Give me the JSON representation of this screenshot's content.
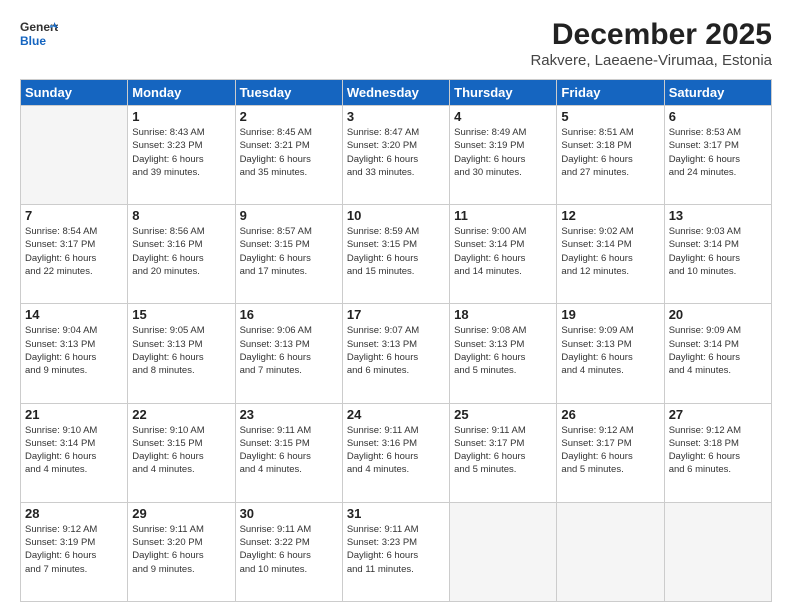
{
  "header": {
    "logo_line1": "General",
    "logo_line2": "Blue",
    "title": "December 2025",
    "subtitle": "Rakvere, Laeaene-Virumaa, Estonia"
  },
  "days_of_week": [
    "Sunday",
    "Monday",
    "Tuesday",
    "Wednesday",
    "Thursday",
    "Friday",
    "Saturday"
  ],
  "weeks": [
    [
      {
        "day": "",
        "info": ""
      },
      {
        "day": "1",
        "info": "Sunrise: 8:43 AM\nSunset: 3:23 PM\nDaylight: 6 hours\nand 39 minutes."
      },
      {
        "day": "2",
        "info": "Sunrise: 8:45 AM\nSunset: 3:21 PM\nDaylight: 6 hours\nand 35 minutes."
      },
      {
        "day": "3",
        "info": "Sunrise: 8:47 AM\nSunset: 3:20 PM\nDaylight: 6 hours\nand 33 minutes."
      },
      {
        "day": "4",
        "info": "Sunrise: 8:49 AM\nSunset: 3:19 PM\nDaylight: 6 hours\nand 30 minutes."
      },
      {
        "day": "5",
        "info": "Sunrise: 8:51 AM\nSunset: 3:18 PM\nDaylight: 6 hours\nand 27 minutes."
      },
      {
        "day": "6",
        "info": "Sunrise: 8:53 AM\nSunset: 3:17 PM\nDaylight: 6 hours\nand 24 minutes."
      }
    ],
    [
      {
        "day": "7",
        "info": "Sunrise: 8:54 AM\nSunset: 3:17 PM\nDaylight: 6 hours\nand 22 minutes."
      },
      {
        "day": "8",
        "info": "Sunrise: 8:56 AM\nSunset: 3:16 PM\nDaylight: 6 hours\nand 20 minutes."
      },
      {
        "day": "9",
        "info": "Sunrise: 8:57 AM\nSunset: 3:15 PM\nDaylight: 6 hours\nand 17 minutes."
      },
      {
        "day": "10",
        "info": "Sunrise: 8:59 AM\nSunset: 3:15 PM\nDaylight: 6 hours\nand 15 minutes."
      },
      {
        "day": "11",
        "info": "Sunrise: 9:00 AM\nSunset: 3:14 PM\nDaylight: 6 hours\nand 14 minutes."
      },
      {
        "day": "12",
        "info": "Sunrise: 9:02 AM\nSunset: 3:14 PM\nDaylight: 6 hours\nand 12 minutes."
      },
      {
        "day": "13",
        "info": "Sunrise: 9:03 AM\nSunset: 3:14 PM\nDaylight: 6 hours\nand 10 minutes."
      }
    ],
    [
      {
        "day": "14",
        "info": "Sunrise: 9:04 AM\nSunset: 3:13 PM\nDaylight: 6 hours\nand 9 minutes."
      },
      {
        "day": "15",
        "info": "Sunrise: 9:05 AM\nSunset: 3:13 PM\nDaylight: 6 hours\nand 8 minutes."
      },
      {
        "day": "16",
        "info": "Sunrise: 9:06 AM\nSunset: 3:13 PM\nDaylight: 6 hours\nand 7 minutes."
      },
      {
        "day": "17",
        "info": "Sunrise: 9:07 AM\nSunset: 3:13 PM\nDaylight: 6 hours\nand 6 minutes."
      },
      {
        "day": "18",
        "info": "Sunrise: 9:08 AM\nSunset: 3:13 PM\nDaylight: 6 hours\nand 5 minutes."
      },
      {
        "day": "19",
        "info": "Sunrise: 9:09 AM\nSunset: 3:13 PM\nDaylight: 6 hours\nand 4 minutes."
      },
      {
        "day": "20",
        "info": "Sunrise: 9:09 AM\nSunset: 3:14 PM\nDaylight: 6 hours\nand 4 minutes."
      }
    ],
    [
      {
        "day": "21",
        "info": "Sunrise: 9:10 AM\nSunset: 3:14 PM\nDaylight: 6 hours\nand 4 minutes."
      },
      {
        "day": "22",
        "info": "Sunrise: 9:10 AM\nSunset: 3:15 PM\nDaylight: 6 hours\nand 4 minutes."
      },
      {
        "day": "23",
        "info": "Sunrise: 9:11 AM\nSunset: 3:15 PM\nDaylight: 6 hours\nand 4 minutes."
      },
      {
        "day": "24",
        "info": "Sunrise: 9:11 AM\nSunset: 3:16 PM\nDaylight: 6 hours\nand 4 minutes."
      },
      {
        "day": "25",
        "info": "Sunrise: 9:11 AM\nSunset: 3:17 PM\nDaylight: 6 hours\nand 5 minutes."
      },
      {
        "day": "26",
        "info": "Sunrise: 9:12 AM\nSunset: 3:17 PM\nDaylight: 6 hours\nand 5 minutes."
      },
      {
        "day": "27",
        "info": "Sunrise: 9:12 AM\nSunset: 3:18 PM\nDaylight: 6 hours\nand 6 minutes."
      }
    ],
    [
      {
        "day": "28",
        "info": "Sunrise: 9:12 AM\nSunset: 3:19 PM\nDaylight: 6 hours\nand 7 minutes."
      },
      {
        "day": "29",
        "info": "Sunrise: 9:11 AM\nSunset: 3:20 PM\nDaylight: 6 hours\nand 9 minutes."
      },
      {
        "day": "30",
        "info": "Sunrise: 9:11 AM\nSunset: 3:22 PM\nDaylight: 6 hours\nand 10 minutes."
      },
      {
        "day": "31",
        "info": "Sunrise: 9:11 AM\nSunset: 3:23 PM\nDaylight: 6 hours\nand 11 minutes."
      },
      {
        "day": "",
        "info": ""
      },
      {
        "day": "",
        "info": ""
      },
      {
        "day": "",
        "info": ""
      }
    ]
  ]
}
